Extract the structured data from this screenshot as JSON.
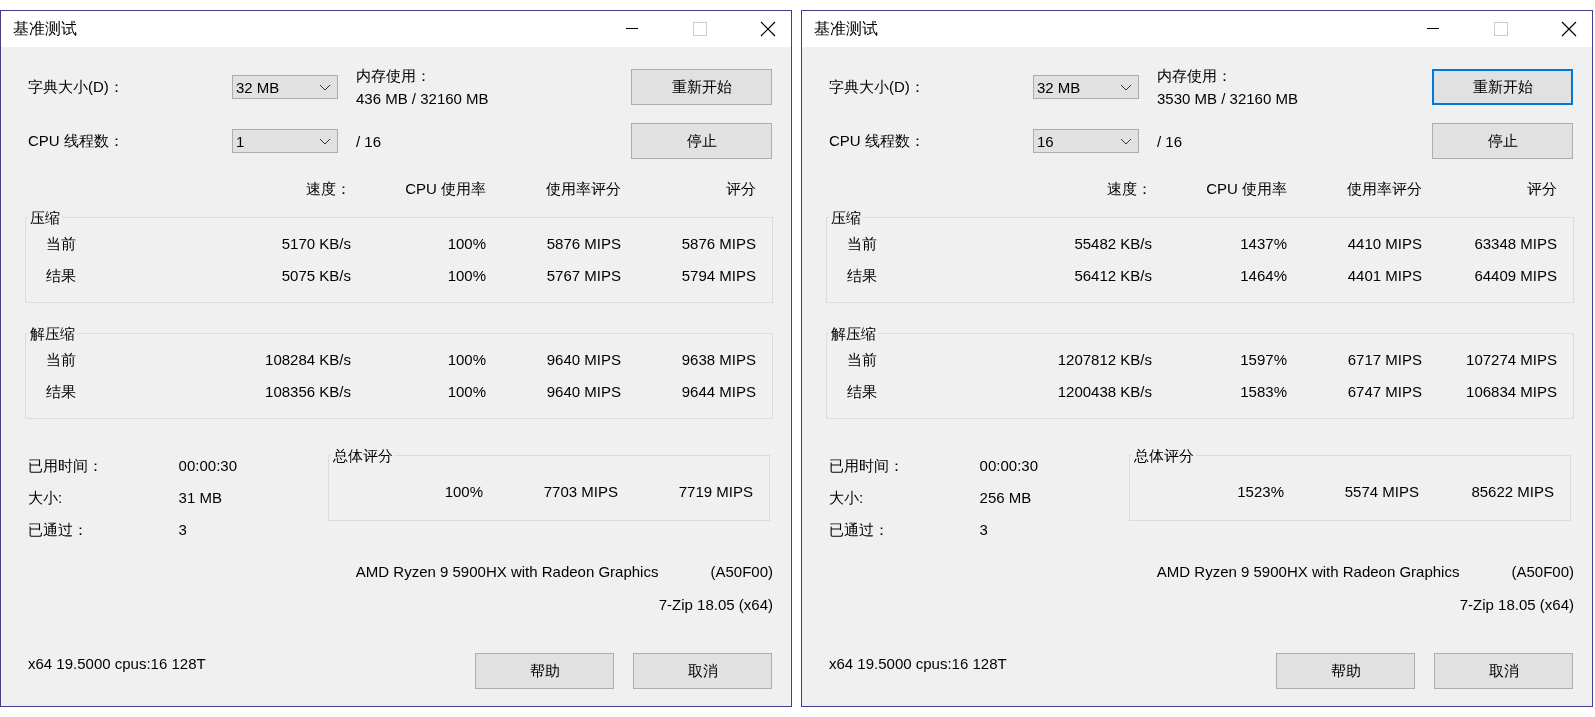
{
  "windows": [
    {
      "title": "基准测试",
      "dictionary": {
        "label": "字典大小(D)：",
        "value": "32 MB"
      },
      "threads": {
        "label": "CPU 线程数：",
        "value": "1",
        "max": "/ 16"
      },
      "memory": {
        "label": "内存使用：",
        "value": "436 MB / 32160 MB"
      },
      "restart_button": {
        "label": "重新开始",
        "focused": false
      },
      "stop_button": "停止",
      "columns": [
        "速度：",
        "CPU 使用率",
        "使用率评分",
        "评分"
      ],
      "groups": [
        {
          "title": "压缩",
          "rows": [
            {
              "label": "当前",
              "values": [
                "5170 KB/s",
                "100%",
                "5876 MIPS",
                "5876 MIPS"
              ]
            },
            {
              "label": "结果",
              "values": [
                "5075 KB/s",
                "100%",
                "5767 MIPS",
                "5794 MIPS"
              ]
            }
          ]
        },
        {
          "title": "解压缩",
          "rows": [
            {
              "label": "当前",
              "values": [
                "108284 KB/s",
                "100%",
                "9640 MIPS",
                "9638 MIPS"
              ]
            },
            {
              "label": "结果",
              "values": [
                "108356 KB/s",
                "100%",
                "9640 MIPS",
                "9644 MIPS"
              ]
            }
          ]
        }
      ],
      "stats": [
        {
          "label": "已用时间：",
          "value": "00:00:30"
        },
        {
          "label": "大小:",
          "value": "31 MB"
        },
        {
          "label": "已通过：",
          "value": "3"
        }
      ],
      "total": {
        "title": "总体评分",
        "values": [
          "100%",
          "7703 MIPS",
          "7719 MIPS"
        ]
      },
      "cpu": "AMD Ryzen 9 5900HX with Radeon Graphics",
      "cpu_id": "(A50F00)",
      "version": "7-Zip 18.05 (x64)",
      "info": "x64 19.5000 cpus:16 128T",
      "buttons": [
        "帮助",
        "取消"
      ]
    },
    {
      "title": "基准测试",
      "dictionary": {
        "label": "字典大小(D)：",
        "value": "32 MB"
      },
      "threads": {
        "label": "CPU 线程数：",
        "value": "16",
        "max": "/ 16"
      },
      "memory": {
        "label": "内存使用：",
        "value": "3530 MB / 32160 MB"
      },
      "restart_button": {
        "label": "重新开始",
        "focused": true
      },
      "stop_button": "停止",
      "columns": [
        "速度：",
        "CPU 使用率",
        "使用率评分",
        "评分"
      ],
      "groups": [
        {
          "title": "压缩",
          "rows": [
            {
              "label": "当前",
              "values": [
                "55482 KB/s",
                "1437%",
                "4410 MIPS",
                "63348 MIPS"
              ]
            },
            {
              "label": "结果",
              "values": [
                "56412 KB/s",
                "1464%",
                "4401 MIPS",
                "64409 MIPS"
              ]
            }
          ]
        },
        {
          "title": "解压缩",
          "rows": [
            {
              "label": "当前",
              "values": [
                "1207812 KB/s",
                "1597%",
                "6717 MIPS",
                "107274 MIPS"
              ]
            },
            {
              "label": "结果",
              "values": [
                "1200438 KB/s",
                "1583%",
                "6747 MIPS",
                "106834 MIPS"
              ]
            }
          ]
        }
      ],
      "stats": [
        {
          "label": "已用时间：",
          "value": "00:00:30"
        },
        {
          "label": "大小:",
          "value": "256 MB"
        },
        {
          "label": "已通过：",
          "value": "3"
        }
      ],
      "total": {
        "title": "总体评分",
        "values": [
          "1523%",
          "5574 MIPS",
          "85622 MIPS"
        ]
      },
      "cpu": "AMD Ryzen 9 5900HX with Radeon Graphics",
      "cpu_id": "(A50F00)",
      "version": "7-Zip 18.05 (x64)",
      "info": "x64 19.5000 cpus:16 128T",
      "buttons": [
        "帮助",
        "取消"
      ]
    }
  ]
}
